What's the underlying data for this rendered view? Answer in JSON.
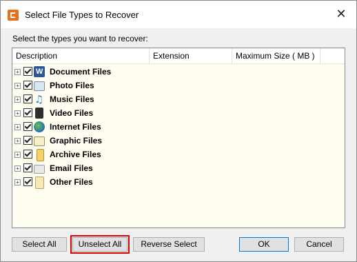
{
  "window": {
    "title": "Select File Types to Recover",
    "close_glyph": "✕"
  },
  "prompt": "Select the types you want to recover:",
  "table": {
    "columns": [
      "Description",
      "Extension",
      "Maximum Size ( MB )"
    ],
    "rows": [
      {
        "label": "Document Files",
        "icon": "document-icon",
        "checked": true
      },
      {
        "label": "Photo Files",
        "icon": "photo-icon",
        "checked": true
      },
      {
        "label": "Music Files",
        "icon": "music-icon",
        "checked": true
      },
      {
        "label": "Video Files",
        "icon": "video-icon",
        "checked": true
      },
      {
        "label": "Internet Files",
        "icon": "internet-icon",
        "checked": true
      },
      {
        "label": "Graphic Files",
        "icon": "graphic-icon",
        "checked": true
      },
      {
        "label": "Archive Files",
        "icon": "archive-icon",
        "checked": true
      },
      {
        "label": "Email Files",
        "icon": "email-icon",
        "checked": true
      },
      {
        "label": "Other Files",
        "icon": "other-icon",
        "checked": true
      }
    ]
  },
  "buttons": {
    "select_all": "Select All",
    "unselect_all": "Unselect All",
    "reverse_select": "Reverse Select",
    "ok": "OK",
    "cancel": "Cancel"
  },
  "colors": {
    "highlight_outline": "#e00000",
    "list_background": "#fffdf0",
    "default_button_border": "#0078d7"
  }
}
